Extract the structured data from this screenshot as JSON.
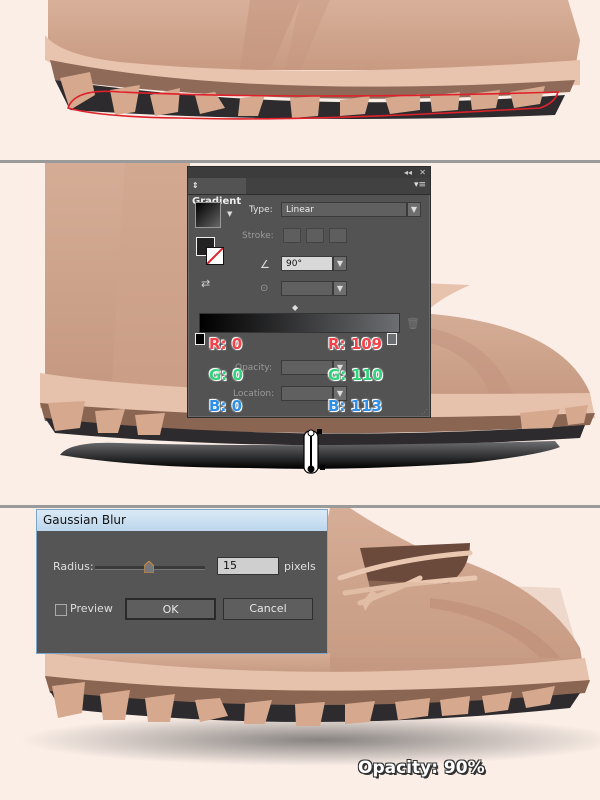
{
  "gradient_panel": {
    "tab_title": "Gradient",
    "collapse_glyph": "◂◂",
    "close_glyph": "✕",
    "menu_glyph": "▾≡",
    "type_label": "Type:",
    "type_value": "Linear",
    "stroke_label": "Stroke:",
    "angle_value": "90°",
    "opacity_label": "Opacity:",
    "location_label": "Location:",
    "colors": {
      "start": "#000000",
      "end": "#6d6e71"
    }
  },
  "rgb_left": {
    "r": "R: 0",
    "g": "G: 0",
    "b": "B: 0"
  },
  "rgb_right": {
    "r": "R: 109",
    "g": "G: 110",
    "b": "B: 113"
  },
  "gaussian_dialog": {
    "title": "Gaussian Blur",
    "radius_label": "Radius:",
    "radius_value": "15",
    "unit": "pixels",
    "preview_label": "Preview",
    "ok_label": "OK",
    "cancel_label": "Cancel",
    "slider_level": 0.5
  },
  "opacity_note": "Opacity: 90%",
  "accent_colors": {
    "selection": "#e0212b",
    "r": "#f2424a",
    "g": "#2ed37a",
    "b": "#2f8fe6"
  }
}
